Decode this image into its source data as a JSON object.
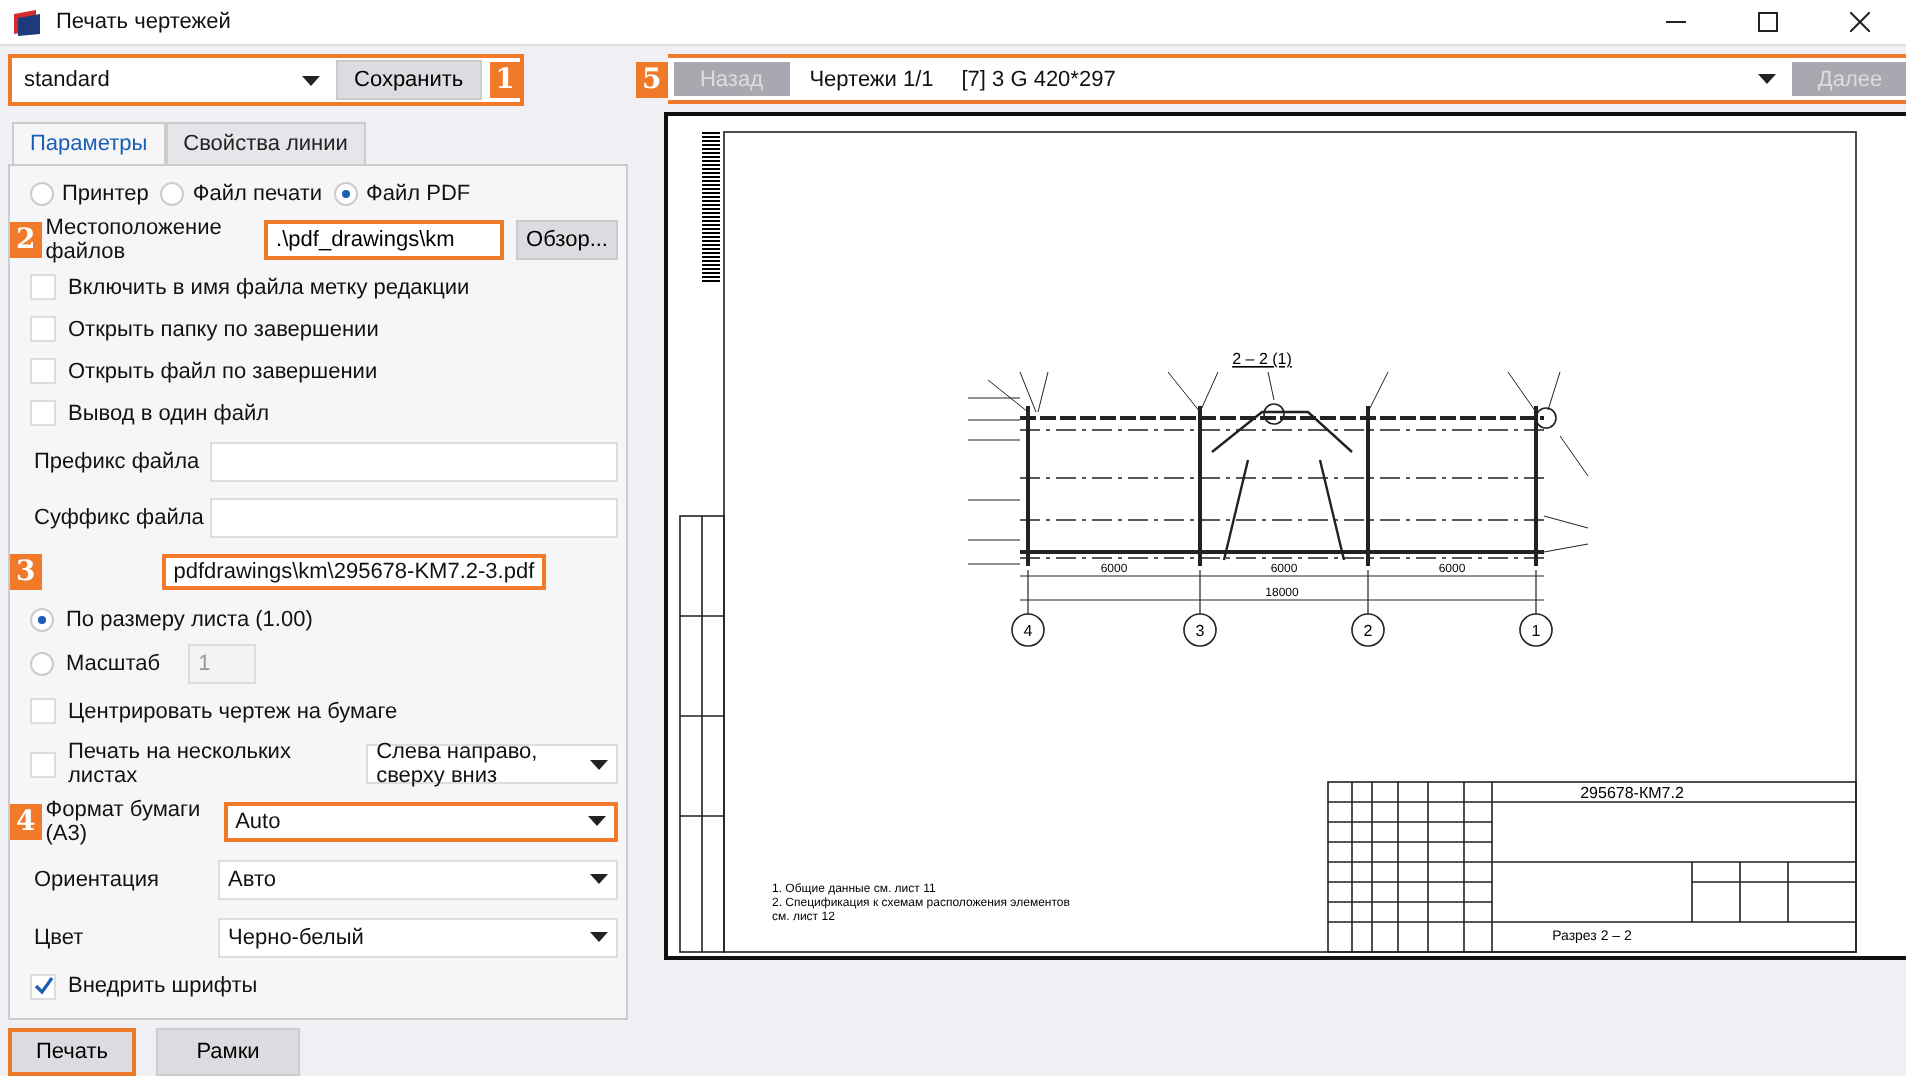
{
  "window": {
    "title": "Печать чертежей"
  },
  "preset": {
    "callout": "1",
    "value": "standard",
    "save_button": "Сохранить"
  },
  "tabs": [
    {
      "label": "Параметры",
      "selected": true
    },
    {
      "label": "Свойства линии",
      "selected": false
    }
  ],
  "output": [
    {
      "label": "Принтер",
      "selected": false
    },
    {
      "label": "Файл печати",
      "selected": false
    },
    {
      "label": "Файл PDF",
      "selected": true
    }
  ],
  "location": {
    "callout": "2",
    "label": "Местоположение файлов",
    "value": ".\\pdf_drawings\\km",
    "highlighted": true,
    "browse_button": "Обзор..."
  },
  "options": [
    {
      "label": "Включить в имя файла метку редакции",
      "checked": false
    },
    {
      "label": "Открыть папку по завершении",
      "checked": false
    },
    {
      "label": "Открыть файл по завершении",
      "checked": false
    },
    {
      "label": "Вывод в один файл",
      "checked": false
    }
  ],
  "affixes": [
    {
      "label": "Префикс файла"
    },
    {
      "label": "Суффикс файла"
    }
  ],
  "filename": {
    "callout": "3",
    "value": "pdfdrawings\\km\\295678-KM7.2-3.pdf",
    "highlighted": true
  },
  "scaling": [
    {
      "label": "По размеру листа (1.00)",
      "selected": true
    },
    {
      "label": "Масштаб",
      "selected": false,
      "value": "1",
      "disabled": true
    }
  ],
  "center": {
    "label": "Центрировать чертеж на бумаге",
    "checked": false
  },
  "multi": {
    "label": "Печать на нескольких листах",
    "checked": false,
    "order": "Слева направо, сверху вниз"
  },
  "selects": [
    {
      "callout": "4",
      "label": "Формат бумаги (А3)",
      "value": "Auto",
      "highlighted": true
    },
    {
      "label": "Ориентация",
      "value": "Авто",
      "highlighted": false
    },
    {
      "label": "Цвет",
      "value": "Черно-белый",
      "highlighted": false
    }
  ],
  "embed": {
    "label": "Внедрить шрифты",
    "checked": true
  },
  "buttons": [
    {
      "label": "Печать",
      "highlighted": true
    },
    {
      "label": "Рамки",
      "highlighted": false
    }
  ],
  "preview": {
    "callout": "5",
    "back": "Назад",
    "back_disabled": true,
    "counter": "Чертежи 1/1",
    "sheet": "[7] 3 G 420*297",
    "next": "Далее",
    "next_disabled": true,
    "drawing": {
      "title": "2 – 2 (1)",
      "spans": [
        "6000",
        "6000",
        "6000"
      ],
      "total": "18000",
      "axes": [
        "4",
        "3",
        "2",
        "1"
      ],
      "notes": [
        "1. Общие данные см. лист 11",
        "2. Спецификация к схемам расположения элементов",
        "см. лист 12"
      ],
      "code": "295678-КМ7.2",
      "sheet_name": "Разрез 2 – 2"
    }
  }
}
